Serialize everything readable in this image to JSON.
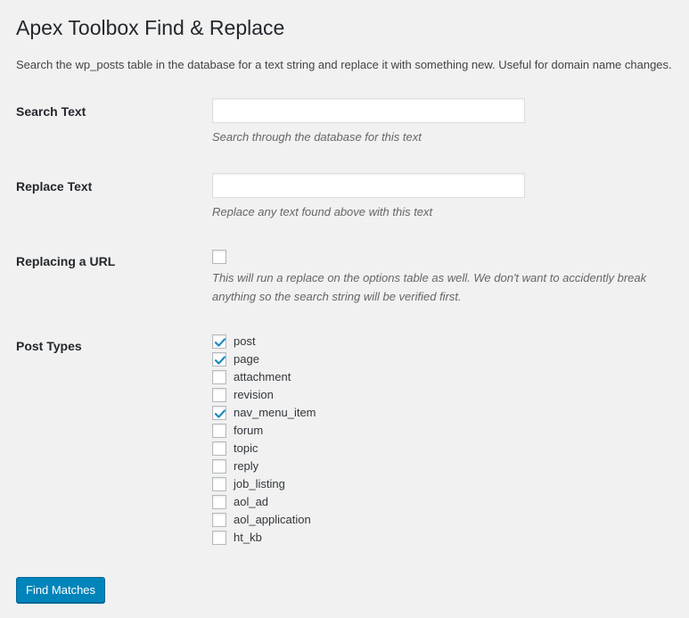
{
  "title": "Apex Toolbox Find & Replace",
  "description": "Search the wp_posts table in the database for a text string and replace it with something new. Useful for domain name changes.",
  "search": {
    "label": "Search Text",
    "value": "",
    "hint": "Search through the database for this text"
  },
  "replace": {
    "label": "Replace Text",
    "value": "",
    "hint": "Replace any text found above with this text"
  },
  "url": {
    "label": "Replacing a URL",
    "checked": false,
    "hint_line1": "This will run a replace on the options table as well. We don't want to accidently break",
    "hint_line2": "anything so the search string will be verified first."
  },
  "post_types": {
    "label": "Post Types",
    "items": [
      {
        "label": "post",
        "checked": true
      },
      {
        "label": "page",
        "checked": true
      },
      {
        "label": "attachment",
        "checked": false
      },
      {
        "label": "revision",
        "checked": false
      },
      {
        "label": "nav_menu_item",
        "checked": true
      },
      {
        "label": "forum",
        "checked": false
      },
      {
        "label": "topic",
        "checked": false
      },
      {
        "label": "reply",
        "checked": false
      },
      {
        "label": "job_listing",
        "checked": false
      },
      {
        "label": "aol_ad",
        "checked": false
      },
      {
        "label": "aol_application",
        "checked": false
      },
      {
        "label": "ht_kb",
        "checked": false
      }
    ]
  },
  "submit_label": "Find Matches",
  "colors": {
    "background": "#f1f1f1",
    "primary_button": "#0085ba",
    "checkmark": "#1e8cbe"
  }
}
